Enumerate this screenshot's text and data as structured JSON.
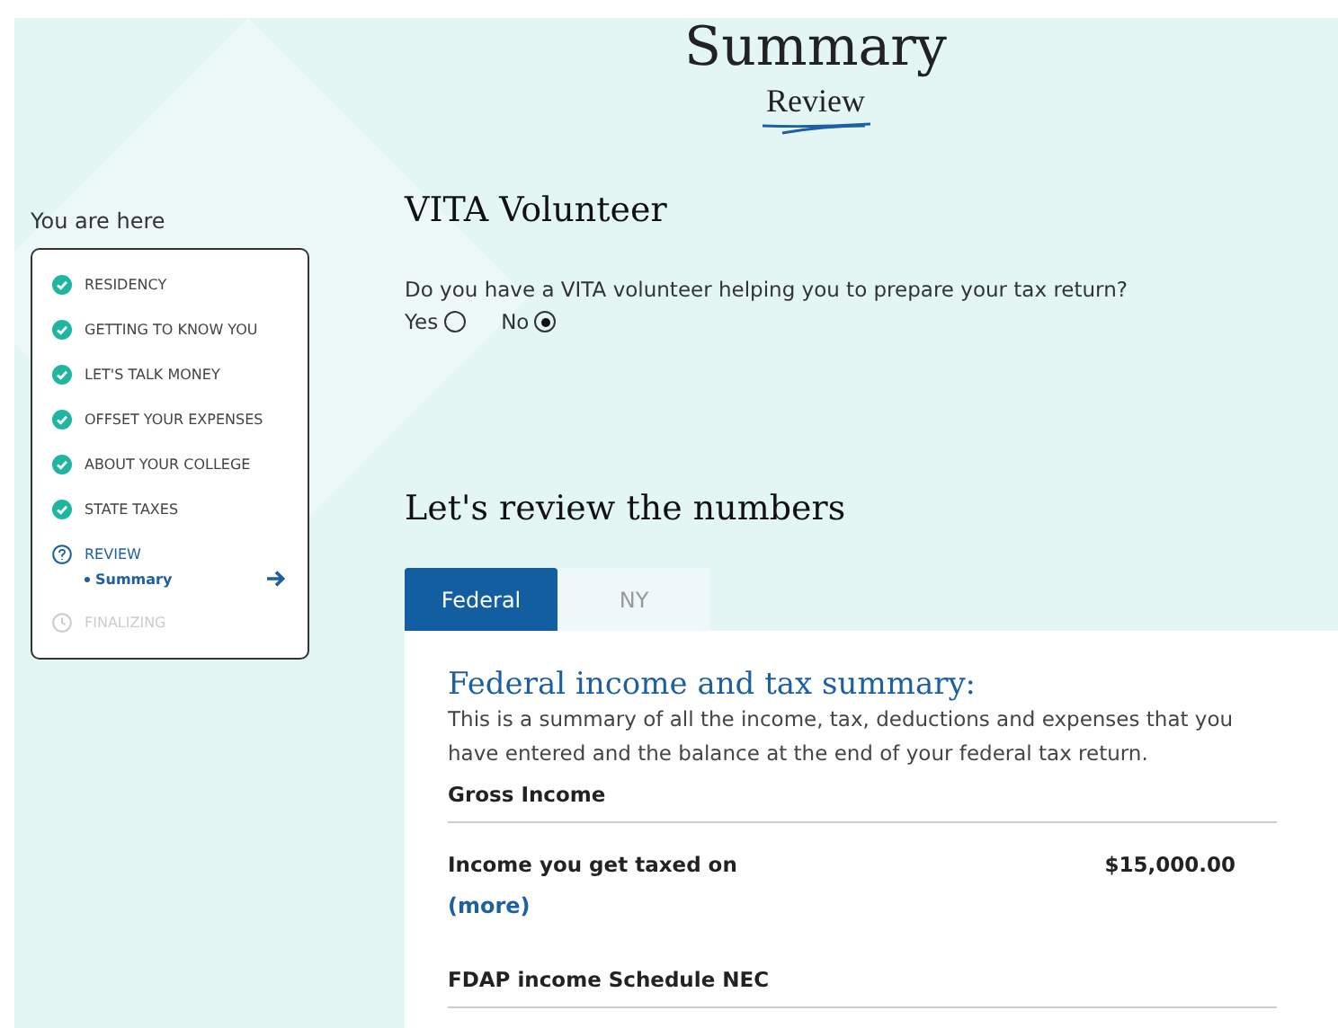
{
  "header": {
    "title": "Summary",
    "subtitle": "Review"
  },
  "progress": {
    "label": "You are here",
    "steps": [
      {
        "label": "RESIDENCY",
        "kind": "done"
      },
      {
        "label": "GETTING TO KNOW YOU",
        "kind": "done"
      },
      {
        "label": "LET'S TALK MONEY",
        "kind": "done"
      },
      {
        "label": "OFFSET YOUR EXPENSES",
        "kind": "done"
      },
      {
        "label": "ABOUT YOUR COLLEGE",
        "kind": "done"
      },
      {
        "label": "STATE TAXES",
        "kind": "done"
      },
      {
        "label": "REVIEW",
        "kind": "current",
        "children": [
          {
            "label": "Summary",
            "selected": true
          }
        ]
      },
      {
        "label": "FINALIZING",
        "kind": "pending"
      }
    ]
  },
  "volunteer": {
    "heading": "VITA Volunteer",
    "question": "Do you have a VITA volunteer helping you to prepare your tax return?",
    "options": [
      {
        "label": "Yes",
        "selected": false
      },
      {
        "label": "No",
        "selected": true
      }
    ]
  },
  "review": {
    "heading": "Let's review the numbers",
    "tabs": [
      {
        "label": "Federal",
        "selected": true
      },
      {
        "label": "NY",
        "selected": false
      }
    ],
    "panel": {
      "title": "Federal income and tax summary:",
      "description": "This is a summary of all the income, tax, deductions and expenses that you have entered and the balance at the end of your federal tax return.",
      "sections": [
        {
          "heading": "Gross Income",
          "rows": [
            {
              "label": "Income you get taxed on",
              "amount": "$15,000.00",
              "link": "(more)"
            }
          ]
        },
        {
          "heading": "FDAP income Schedule NEC"
        }
      ]
    }
  }
}
